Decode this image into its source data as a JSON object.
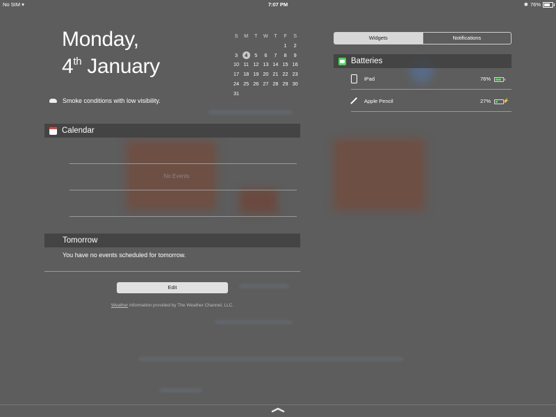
{
  "status_bar": {
    "carrier": "No SIM",
    "time": "7:07 PM",
    "battery_percent": "76%",
    "battery_level": 0.76
  },
  "date": {
    "line1": "Monday,",
    "day": "4",
    "ordinal": "th",
    "month": "January"
  },
  "mini_calendar": {
    "weekdays": [
      "S",
      "M",
      "T",
      "W",
      "T",
      "F",
      "S"
    ],
    "weeks": [
      [
        "",
        "",
        "",
        "",
        "",
        "1",
        "2"
      ],
      [
        "3",
        "4",
        "5",
        "6",
        "7",
        "8",
        "9"
      ],
      [
        "10",
        "11",
        "12",
        "13",
        "14",
        "15",
        "16"
      ],
      [
        "17",
        "18",
        "19",
        "20",
        "21",
        "22",
        "23"
      ],
      [
        "24",
        "25",
        "26",
        "27",
        "28",
        "29",
        "30"
      ],
      [
        "31",
        "",
        "",
        "",
        "",
        "",
        ""
      ]
    ],
    "today": "4"
  },
  "weather": {
    "text": "Smoke conditions with low visibility.",
    "icon": "cloud-icon"
  },
  "calendar_widget": {
    "title": "Calendar",
    "icon": "calendar-app-icon",
    "empty_text": "No Events"
  },
  "tomorrow": {
    "title": "Tomorrow",
    "text": "You have no events scheduled for tomorrow."
  },
  "edit_button": {
    "label": "Edit"
  },
  "credit": {
    "link": "Weather",
    "text": " information provided by The Weather Channel, LLC."
  },
  "segmented": {
    "tabs": [
      "Widgets",
      "Notifications"
    ],
    "selected": "Widgets"
  },
  "batteries": {
    "title": "Batteries",
    "icon": "battery-widget-icon",
    "devices": [
      {
        "name": "iPad",
        "percent": "76%",
        "level": 0.76,
        "charging": false,
        "icon": "ipad-icon"
      },
      {
        "name": "Apple Pencil",
        "percent": "27%",
        "level": 0.27,
        "charging": true,
        "icon": "pencil-icon"
      }
    ]
  },
  "colors": {
    "battery_green": "#4cd35d",
    "calendar_red": "#e5433b"
  }
}
